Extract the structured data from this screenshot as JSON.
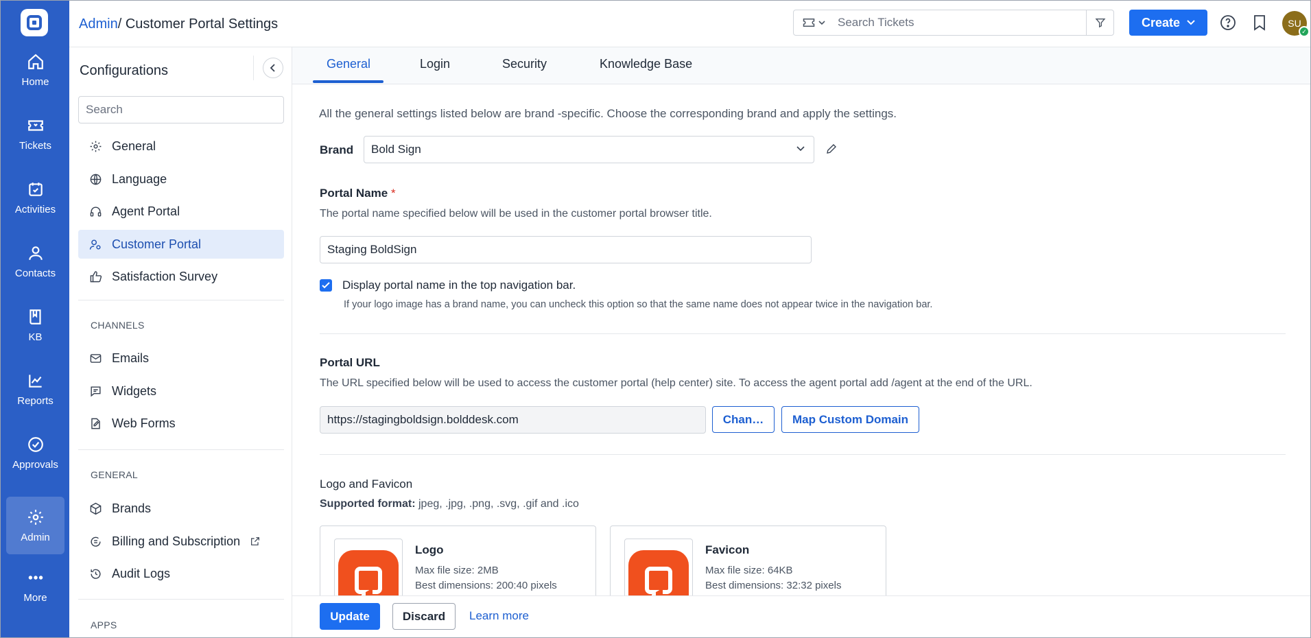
{
  "nav": {
    "items": [
      {
        "label": "Home",
        "icon": "home-icon"
      },
      {
        "label": "Tickets",
        "icon": "ticket-icon"
      },
      {
        "label": "Activities",
        "icon": "calendar-check-icon"
      },
      {
        "label": "Contacts",
        "icon": "person-icon"
      },
      {
        "label": "KB",
        "icon": "book-icon"
      },
      {
        "label": "Reports",
        "icon": "chart-line-icon"
      },
      {
        "label": "Approvals",
        "icon": "check-circle-icon"
      },
      {
        "label": "Admin",
        "icon": "gear-icon",
        "active": true
      },
      {
        "label": "More",
        "icon": "more-dots-icon"
      }
    ]
  },
  "header": {
    "breadcrumb_link": "Admin",
    "breadcrumb_current": "/ Customer Portal Settings",
    "search_placeholder": "Search Tickets",
    "create_label": "Create",
    "avatar_initials": "SU"
  },
  "config": {
    "title": "Configurations",
    "search_placeholder": "Search",
    "items": [
      {
        "label": "General",
        "icon": "gear-icon"
      },
      {
        "label": "Language",
        "icon": "globe-icon"
      },
      {
        "label": "Agent Portal",
        "icon": "headset-icon"
      },
      {
        "label": "Customer Portal",
        "icon": "user-gear-icon",
        "active": true
      },
      {
        "label": "Satisfaction Survey",
        "icon": "thumbs-up-icon"
      }
    ],
    "channels_heading": "CHANNELS",
    "channels": [
      {
        "label": "Emails",
        "icon": "mail-icon"
      },
      {
        "label": "Widgets",
        "icon": "chat-icon"
      },
      {
        "label": "Web Forms",
        "icon": "form-edit-icon"
      }
    ],
    "general_heading": "GENERAL",
    "general": [
      {
        "label": "Brands",
        "icon": "cube-icon"
      },
      {
        "label": "Billing and Subscription",
        "icon": "billing-icon"
      },
      {
        "label": "Audit Logs",
        "icon": "history-icon"
      }
    ],
    "apps_heading": "APPS"
  },
  "tabs": [
    "General",
    "Login",
    "Security",
    "Knowledge Base"
  ],
  "active_tab": "General",
  "main": {
    "intro": "All the general settings listed below are brand -specific. Choose the corresponding brand and apply the settings.",
    "brand_label": "Brand",
    "brand_value": "Bold Sign",
    "portal_name_label": "Portal Name",
    "required_mark": "*",
    "portal_name_desc": "The portal name specified below will be used in the customer portal browser title.",
    "portal_name_value": "Staging BoldSign",
    "display_checkbox_label": "Display portal name in the top navigation bar.",
    "display_checkbox_checked": true,
    "display_hint": "If your logo image has a brand name, you can uncheck this option so that the same name does not appear twice in the navigation bar.",
    "portal_url_label": "Portal URL",
    "portal_url_desc": "The URL specified below will be used to access the customer portal (help center) site. To access the agent portal add /agent at the end of the URL.",
    "portal_url_value": "https://stagingboldsign.bolddesk.com",
    "change_button": "Chan…",
    "map_domain_button": "Map Custom Domain",
    "logo_heading": "Logo and Favicon",
    "formats_label": "Supported format:",
    "formats_value": " jpeg, .jpg, .png, .svg, .gif and .ico",
    "logo_card": {
      "title": "Logo",
      "size": "Max file size: 2MB",
      "dims": "Best dimensions: 200:40 pixels"
    },
    "favicon_card": {
      "title": "Favicon",
      "size": "Max file size: 64KB",
      "dims": "Best dimensions: 32:32 pixels"
    }
  },
  "footer": {
    "update": "Update",
    "discard": "Discard",
    "learn_more": "Learn more"
  },
  "colors": {
    "rail": "#2b5fc6",
    "accent": "#1d6ef0",
    "brand_logo": "#f0501e"
  }
}
